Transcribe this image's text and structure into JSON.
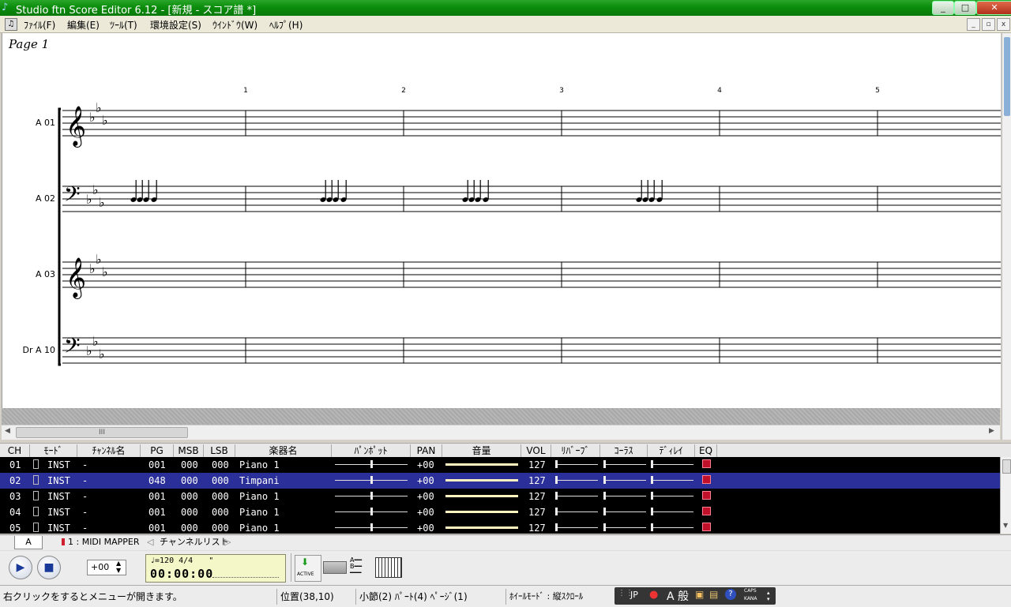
{
  "window": {
    "title": "Studio ftn Score Editor 6.12 - [新規 - スコア譜 *]"
  },
  "menu": [
    "ﾌｧｲﾙ(F)",
    "編集(E)",
    "ﾂｰﾙ(T)",
    "環境設定(S)",
    "ｳｲﾝﾄﾞｳ(W)",
    "ﾍﾙﾌﾟ(H)"
  ],
  "score": {
    "page_label": "Page 1",
    "measures": [
      "1",
      "2",
      "3",
      "4",
      "5"
    ],
    "staves": [
      {
        "label": "A 01",
        "clef": "treble"
      },
      {
        "label": "A 02",
        "clef": "bass"
      },
      {
        "label": "A 03",
        "clef": "treble"
      },
      {
        "label": "Dr A 10",
        "clef": "bass"
      }
    ]
  },
  "table": {
    "headers": [
      "CH",
      "ﾓｰﾄﾞ",
      "ﾁｬﾝﾈﾙ名",
      "PG",
      "MSB",
      "LSB",
      "楽器名",
      "ﾊﾟﾝﾎﾟｯﾄ",
      "PAN",
      "音量",
      "VOL",
      "ﾘﾊﾞｰﾌﾞ",
      "ｺｰﾗｽ",
      "ﾃﾞｨﾚｲ",
      "EQ"
    ],
    "rows": [
      {
        "ch": "01",
        "mode": "INST",
        "name": "-",
        "pg": "001",
        "msb": "000",
        "lsb": "000",
        "instrument": "Piano 1",
        "pan": "+00",
        "vol": "127",
        "selected": false
      },
      {
        "ch": "02",
        "mode": "INST",
        "name": "-",
        "pg": "048",
        "msb": "000",
        "lsb": "000",
        "instrument": "Timpani",
        "pan": "+00",
        "vol": "127",
        "selected": true
      },
      {
        "ch": "03",
        "mode": "INST",
        "name": "-",
        "pg": "001",
        "msb": "000",
        "lsb": "000",
        "instrument": "Piano 1",
        "pan": "+00",
        "vol": "127",
        "selected": false
      },
      {
        "ch": "04",
        "mode": "INST",
        "name": "-",
        "pg": "001",
        "msb": "000",
        "lsb": "000",
        "instrument": "Piano 1",
        "pan": "+00",
        "vol": "127",
        "selected": false
      },
      {
        "ch": "05",
        "mode": "INST",
        "name": "-",
        "pg": "001",
        "msb": "000",
        "lsb": "000",
        "instrument": "Piano 1",
        "pan": "+00",
        "vol": "127",
        "selected": false
      }
    ]
  },
  "tabs": {
    "a": "A",
    "midi": "1 : MIDI MAPPER",
    "chlist": "チャンネルリスト"
  },
  "transport": {
    "transpose": "+00",
    "tempo_line": "♩=120 4/4",
    "time": "00:00:00",
    "active_label": "ACTIVE"
  },
  "status": {
    "hint": "右クリックをするとメニューが開きます。",
    "position": "位置(38,10)",
    "measure_info": "小節(2) ﾊﾟｰﾄ(4) ﾍﾟｰｼﾞ(1)",
    "wheel_mode": "ﾎｲｰﾙﾓｰﾄﾞ : 縦ｽｸﾛｰﾙ",
    "ime": {
      "lang": "JP",
      "mode": "A 般",
      "caps": "CAPS",
      "kana": "KANA"
    }
  }
}
